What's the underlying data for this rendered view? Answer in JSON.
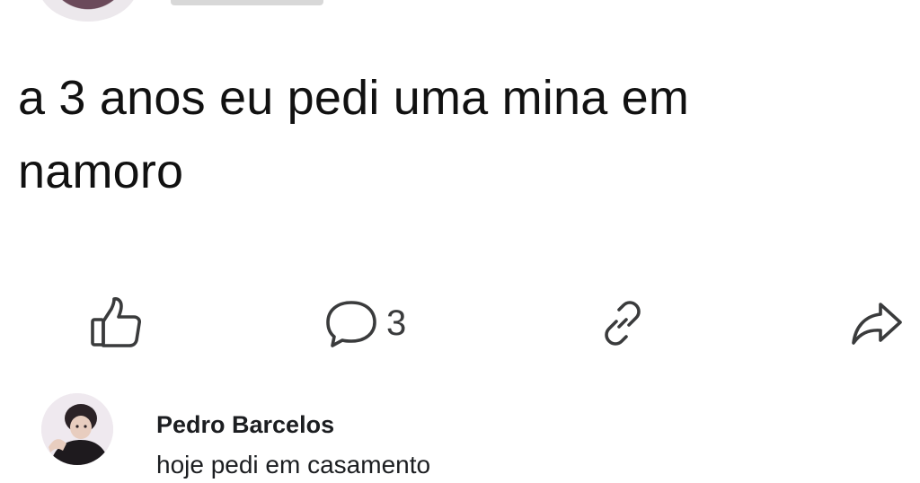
{
  "post": {
    "text_line1": "a 3 anos eu pedi uma mina em",
    "text_line2": "namoro"
  },
  "actions": {
    "like_icon": "thumbs-up-icon",
    "comment_icon": "speech-bubble-icon",
    "comment_count": "3",
    "link_icon": "link-icon",
    "share_icon": "share-arrow-icon"
  },
  "comment": {
    "author": "Pedro Barcelos",
    "text": "hoje pedi em casamento"
  }
}
